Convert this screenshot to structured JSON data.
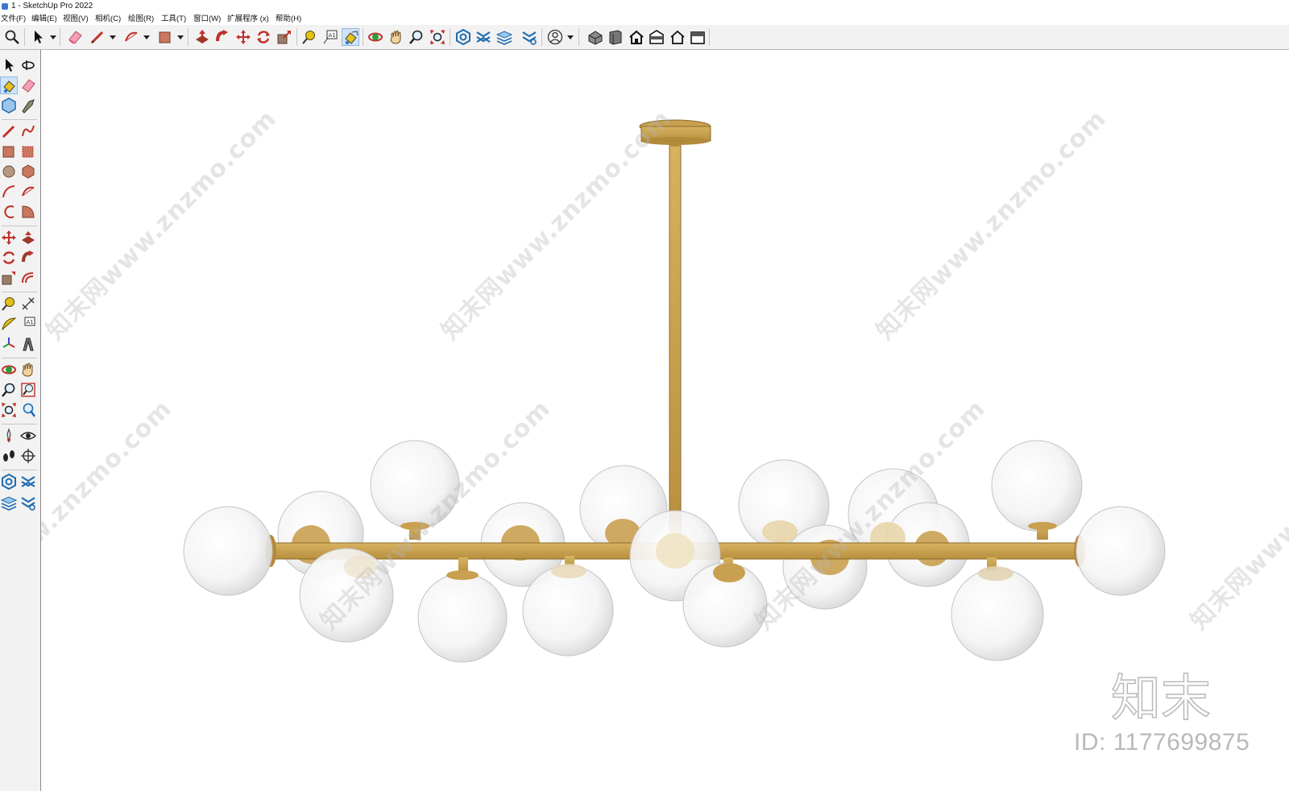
{
  "window": {
    "title": "1 - SketchUp Pro 2022"
  },
  "menubar": {
    "items": [
      "文件(F)",
      "编辑(E)",
      "视图(V)",
      "相机(C)",
      "绘图(R)",
      "工具(T)",
      "窗口(W)",
      "扩展程序 (x)",
      "帮助(H)"
    ]
  },
  "toolbar": {
    "icons": [
      "zoom-icon",
      "select-icon",
      "eraser-icon",
      "pencil-line-icon",
      "arc-icon",
      "rectangle-icon",
      "push-pull-icon",
      "follow-me-icon",
      "move-icon",
      "rotate-icon",
      "scale-icon",
      "tape-measure-icon",
      "text-icon",
      "paint-bucket-icon",
      "orbit-icon",
      "pan-icon",
      "zoom-tool-icon",
      "zoom-extents-icon",
      "warehouse-icon",
      "extension-warehouse-icon",
      "layout-icon",
      "extension-manager-icon",
      "account-icon",
      "iso-view-icon",
      "top-view-icon",
      "front-view-icon",
      "right-view-icon",
      "back-view-icon",
      "left-view-icon"
    ],
    "active_tool": "paint-bucket-icon"
  },
  "left_toolbar": {
    "icons": [
      "select-icon",
      "orbit-small-icon",
      "paint-bucket-icon",
      "eraser-icon",
      "component-icon",
      "tag-icon",
      "line-icon",
      "freehand-icon",
      "rectangle-icon",
      "rotated-rectangle-icon",
      "circle-icon",
      "polygon-icon",
      "arc-icon",
      "two-point-arc-icon",
      "three-point-arc-icon",
      "pie-icon",
      "move-icon",
      "push-pull-icon",
      "rotate-icon",
      "follow-me-icon",
      "scale-icon",
      "offset-icon",
      "tape-measure-icon",
      "dimension-icon",
      "protractor-icon",
      "text-icon",
      "axes-icon",
      "3d-text-icon",
      "orbit-icon",
      "pan-icon",
      "zoom-icon",
      "zoom-window-icon",
      "zoom-extents-icon",
      "previous-view-icon",
      "position-camera-icon",
      "look-around-icon",
      "walk-icon",
      "section-plane-icon",
      "warehouse-icon",
      "extension-warehouse-icon",
      "layout-icon",
      "extension-manager-icon"
    ],
    "active_tool": "paint-bucket-icon"
  },
  "viewport": {
    "model": "chandelier-model",
    "colors": {
      "brass": "#c9a050",
      "brass_dark": "#a9823a",
      "glass": "#f7f7f7",
      "glass_edge": "#c4c4c4"
    }
  },
  "watermark": {
    "text": "知末网www.znzmo.com",
    "logo": "知末",
    "id": "ID: 1177699875"
  }
}
